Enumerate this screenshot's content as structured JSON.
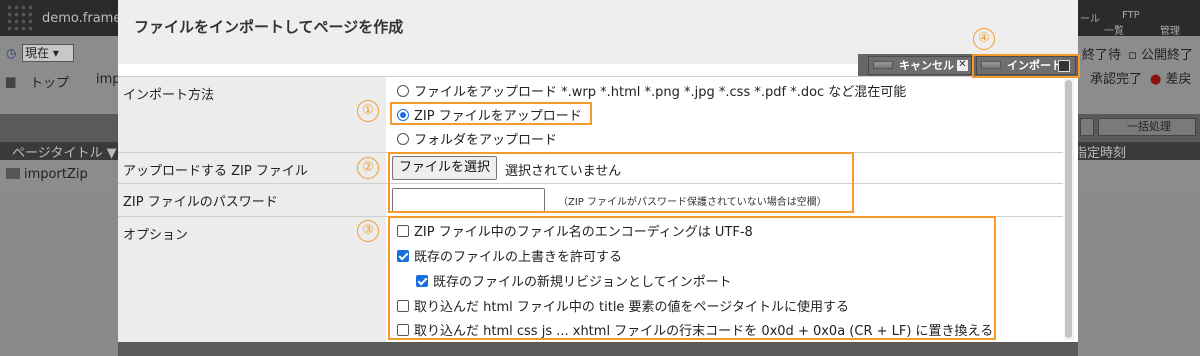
{
  "background": {
    "site_name": "demo.frame",
    "top_right_tab1": "ール",
    "top_right_tab1_sub": "一覧",
    "top_right_tab2": "FTP",
    "top_right_tab2_sub": "管理",
    "time_select": "現在",
    "breadcrumb_top": "トップ",
    "breadcrumb_partial": "imp",
    "status_waiting": "終了待",
    "status_public_end": "公開終了",
    "status_approved": "承認完了",
    "status_returned": "差戻",
    "bulk_action": "一括処理",
    "column_page_title": "ページタイトル ▼",
    "column_scheduled": "指定時刻",
    "row_name": "importZip"
  },
  "modal": {
    "title": "ファイルをインポートしてページを作成",
    "cancel_label": "キャンセル",
    "import_label": "インポート",
    "fields": {
      "import_method_label": "インポート方法",
      "zip_file_label": "アップロードする ZIP ファイル",
      "zip_password_label": "ZIP ファイルのパスワード",
      "options_label": "オプション"
    },
    "import_methods": [
      {
        "label": "ファイルをアップロード *.wrp *.html *.png *.jpg *.css *.pdf *.doc など混在可能",
        "checked": false
      },
      {
        "label": "ZIP ファイルをアップロード",
        "checked": true
      },
      {
        "label": "フォルダをアップロード",
        "checked": false
      }
    ],
    "file_button_label": "ファイルを選択",
    "file_status": "選択されていません",
    "password_value": "",
    "password_note": "（ZIP ファイルがパスワード保護されていない場合は空欄）",
    "options": [
      {
        "label": "ZIP ファイル中のファイル名のエンコーディングは UTF-8",
        "checked": false
      },
      {
        "label": "既存のファイルの上書きを許可する",
        "checked": true
      },
      {
        "label": "既存のファイルの新規リビジョンとしてインポート",
        "checked": true
      },
      {
        "label": "取り込んだ html ファイル中の title 要素の値をページタイトルに使用する",
        "checked": false
      },
      {
        "label": "取り込んだ html css js ... xhtml ファイルの行末コードを 0x0d + 0x0a (CR + LF) に置き換える",
        "checked": false
      }
    ]
  },
  "annotations": {
    "step1": "①",
    "step2": "②",
    "step3": "③",
    "step4": "④",
    "highlight_color": "#f39c2b"
  }
}
